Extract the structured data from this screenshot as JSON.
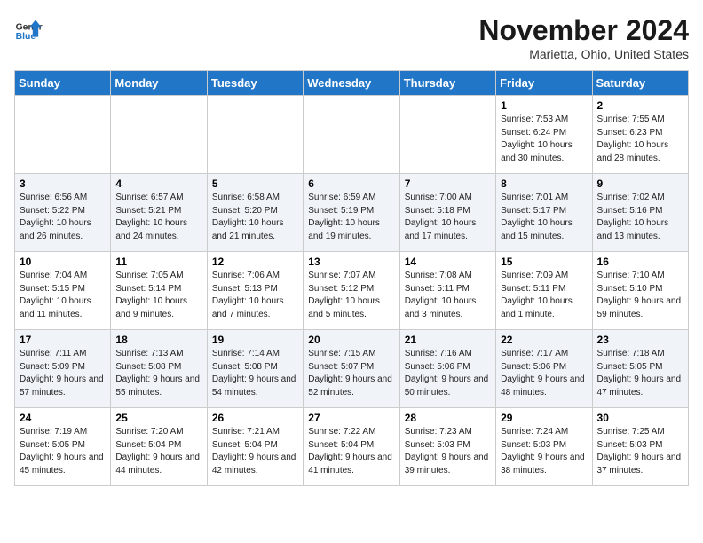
{
  "header": {
    "logo_line1": "General",
    "logo_line2": "Blue",
    "month": "November 2024",
    "location": "Marietta, Ohio, United States"
  },
  "days_of_week": [
    "Sunday",
    "Monday",
    "Tuesday",
    "Wednesday",
    "Thursday",
    "Friday",
    "Saturday"
  ],
  "weeks": [
    [
      {
        "day": "",
        "text": ""
      },
      {
        "day": "",
        "text": ""
      },
      {
        "day": "",
        "text": ""
      },
      {
        "day": "",
        "text": ""
      },
      {
        "day": "",
        "text": ""
      },
      {
        "day": "1",
        "text": "Sunrise: 7:53 AM\nSunset: 6:24 PM\nDaylight: 10 hours and 30 minutes."
      },
      {
        "day": "2",
        "text": "Sunrise: 7:55 AM\nSunset: 6:23 PM\nDaylight: 10 hours and 28 minutes."
      }
    ],
    [
      {
        "day": "3",
        "text": "Sunrise: 6:56 AM\nSunset: 5:22 PM\nDaylight: 10 hours and 26 minutes."
      },
      {
        "day": "4",
        "text": "Sunrise: 6:57 AM\nSunset: 5:21 PM\nDaylight: 10 hours and 24 minutes."
      },
      {
        "day": "5",
        "text": "Sunrise: 6:58 AM\nSunset: 5:20 PM\nDaylight: 10 hours and 21 minutes."
      },
      {
        "day": "6",
        "text": "Sunrise: 6:59 AM\nSunset: 5:19 PM\nDaylight: 10 hours and 19 minutes."
      },
      {
        "day": "7",
        "text": "Sunrise: 7:00 AM\nSunset: 5:18 PM\nDaylight: 10 hours and 17 minutes."
      },
      {
        "day": "8",
        "text": "Sunrise: 7:01 AM\nSunset: 5:17 PM\nDaylight: 10 hours and 15 minutes."
      },
      {
        "day": "9",
        "text": "Sunrise: 7:02 AM\nSunset: 5:16 PM\nDaylight: 10 hours and 13 minutes."
      }
    ],
    [
      {
        "day": "10",
        "text": "Sunrise: 7:04 AM\nSunset: 5:15 PM\nDaylight: 10 hours and 11 minutes."
      },
      {
        "day": "11",
        "text": "Sunrise: 7:05 AM\nSunset: 5:14 PM\nDaylight: 10 hours and 9 minutes."
      },
      {
        "day": "12",
        "text": "Sunrise: 7:06 AM\nSunset: 5:13 PM\nDaylight: 10 hours and 7 minutes."
      },
      {
        "day": "13",
        "text": "Sunrise: 7:07 AM\nSunset: 5:12 PM\nDaylight: 10 hours and 5 minutes."
      },
      {
        "day": "14",
        "text": "Sunrise: 7:08 AM\nSunset: 5:11 PM\nDaylight: 10 hours and 3 minutes."
      },
      {
        "day": "15",
        "text": "Sunrise: 7:09 AM\nSunset: 5:11 PM\nDaylight: 10 hours and 1 minute."
      },
      {
        "day": "16",
        "text": "Sunrise: 7:10 AM\nSunset: 5:10 PM\nDaylight: 9 hours and 59 minutes."
      }
    ],
    [
      {
        "day": "17",
        "text": "Sunrise: 7:11 AM\nSunset: 5:09 PM\nDaylight: 9 hours and 57 minutes."
      },
      {
        "day": "18",
        "text": "Sunrise: 7:13 AM\nSunset: 5:08 PM\nDaylight: 9 hours and 55 minutes."
      },
      {
        "day": "19",
        "text": "Sunrise: 7:14 AM\nSunset: 5:08 PM\nDaylight: 9 hours and 54 minutes."
      },
      {
        "day": "20",
        "text": "Sunrise: 7:15 AM\nSunset: 5:07 PM\nDaylight: 9 hours and 52 minutes."
      },
      {
        "day": "21",
        "text": "Sunrise: 7:16 AM\nSunset: 5:06 PM\nDaylight: 9 hours and 50 minutes."
      },
      {
        "day": "22",
        "text": "Sunrise: 7:17 AM\nSunset: 5:06 PM\nDaylight: 9 hours and 48 minutes."
      },
      {
        "day": "23",
        "text": "Sunrise: 7:18 AM\nSunset: 5:05 PM\nDaylight: 9 hours and 47 minutes."
      }
    ],
    [
      {
        "day": "24",
        "text": "Sunrise: 7:19 AM\nSunset: 5:05 PM\nDaylight: 9 hours and 45 minutes."
      },
      {
        "day": "25",
        "text": "Sunrise: 7:20 AM\nSunset: 5:04 PM\nDaylight: 9 hours and 44 minutes."
      },
      {
        "day": "26",
        "text": "Sunrise: 7:21 AM\nSunset: 5:04 PM\nDaylight: 9 hours and 42 minutes."
      },
      {
        "day": "27",
        "text": "Sunrise: 7:22 AM\nSunset: 5:04 PM\nDaylight: 9 hours and 41 minutes."
      },
      {
        "day": "28",
        "text": "Sunrise: 7:23 AM\nSunset: 5:03 PM\nDaylight: 9 hours and 39 minutes."
      },
      {
        "day": "29",
        "text": "Sunrise: 7:24 AM\nSunset: 5:03 PM\nDaylight: 9 hours and 38 minutes."
      },
      {
        "day": "30",
        "text": "Sunrise: 7:25 AM\nSunset: 5:03 PM\nDaylight: 9 hours and 37 minutes."
      }
    ]
  ]
}
